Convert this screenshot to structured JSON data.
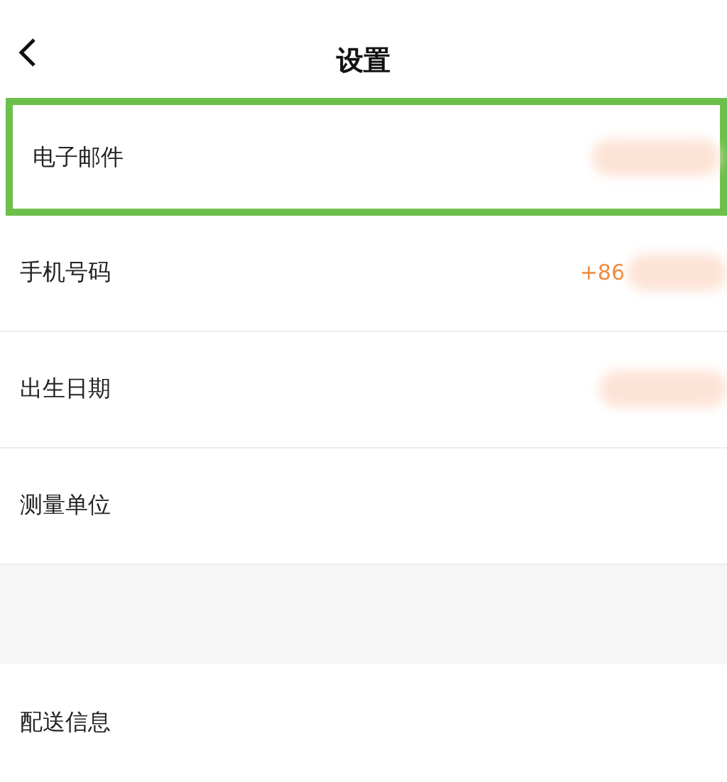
{
  "header": {
    "title": "设置"
  },
  "rows": [
    {
      "label": "电子邮件",
      "highlighted": true,
      "value": null,
      "blurred": true
    },
    {
      "label": "手机号码",
      "highlighted": false,
      "value": "+86",
      "blurred": true
    },
    {
      "label": "出生日期",
      "highlighted": false,
      "value": null,
      "blurred": true
    },
    {
      "label": "测量单位",
      "highlighted": false,
      "value": null,
      "blurred": false
    }
  ],
  "rows_2": [
    {
      "label": "配送信息"
    }
  ]
}
